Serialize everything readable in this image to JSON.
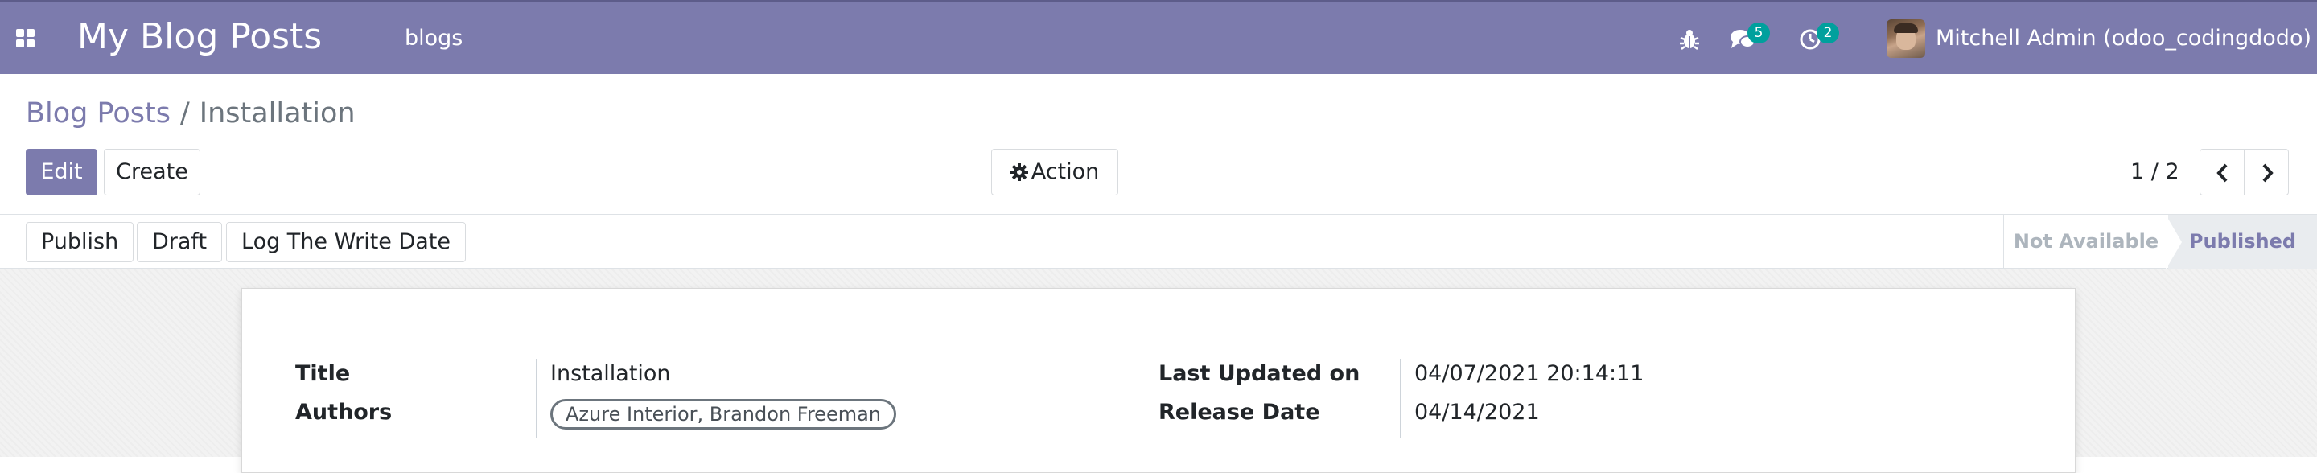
{
  "navbar": {
    "app_title": "My Blog Posts",
    "menu_item": "blogs",
    "messages_count": "5",
    "activities_count": "2",
    "user_name": "Mitchell Admin (odoo_codingdodo)",
    "color": "#7c7bad"
  },
  "breadcrumb": {
    "parent": "Blog Posts",
    "separator": "/",
    "current": "Installation"
  },
  "buttons": {
    "edit": "Edit",
    "create": "Create",
    "action": "Action"
  },
  "pager": {
    "value": "1 / 2"
  },
  "statusbar": {
    "buttons": [
      "Publish",
      "Draft",
      "Log The Write Date"
    ],
    "stages": [
      "Not Available",
      "Published"
    ],
    "active_stage": "Published"
  },
  "form": {
    "title_label": "Title",
    "title_value": "Installation",
    "authors_label": "Authors",
    "authors_tag": "Azure Interior, Brandon Freeman",
    "last_updated_label": "Last Updated on",
    "last_updated_value": "04/07/2021 20:14:11",
    "release_date_label": "Release Date",
    "release_date_value": "04/14/2021"
  },
  "icons": {
    "apps": "apps-grid-icon",
    "debug": "bug-icon",
    "messages": "chat-bubbles-icon",
    "activities": "clock-icon",
    "action": "gear-icon",
    "pager_prev": "chevron-left-icon",
    "pager_next": "chevron-right-icon"
  }
}
